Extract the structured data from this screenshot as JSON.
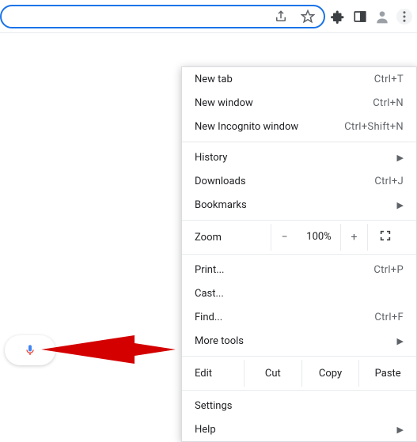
{
  "toolbar": {
    "share_icon": "share-icon",
    "star_icon": "star-icon",
    "extensions_icon": "extensions-icon",
    "sidepanel_icon": "sidepanel-icon",
    "profile_icon": "profile-icon",
    "menu_icon": "more-vert-icon"
  },
  "menu": {
    "new_tab": {
      "label": "New tab",
      "shortcut": "Ctrl+T"
    },
    "new_window": {
      "label": "New window",
      "shortcut": "Ctrl+N"
    },
    "new_incognito": {
      "label": "New Incognito window",
      "shortcut": "Ctrl+Shift+N"
    },
    "history": {
      "label": "History"
    },
    "downloads": {
      "label": "Downloads",
      "shortcut": "Ctrl+J"
    },
    "bookmarks": {
      "label": "Bookmarks"
    },
    "zoom": {
      "label": "Zoom",
      "percent": "100%"
    },
    "print": {
      "label": "Print...",
      "shortcut": "Ctrl+P"
    },
    "cast": {
      "label": "Cast..."
    },
    "find": {
      "label": "Find...",
      "shortcut": "Ctrl+F"
    },
    "more_tools": {
      "label": "More tools"
    },
    "edit": {
      "label": "Edit",
      "cut": "Cut",
      "copy": "Copy",
      "paste": "Paste"
    },
    "settings": {
      "label": "Settings"
    },
    "help": {
      "label": "Help"
    }
  }
}
